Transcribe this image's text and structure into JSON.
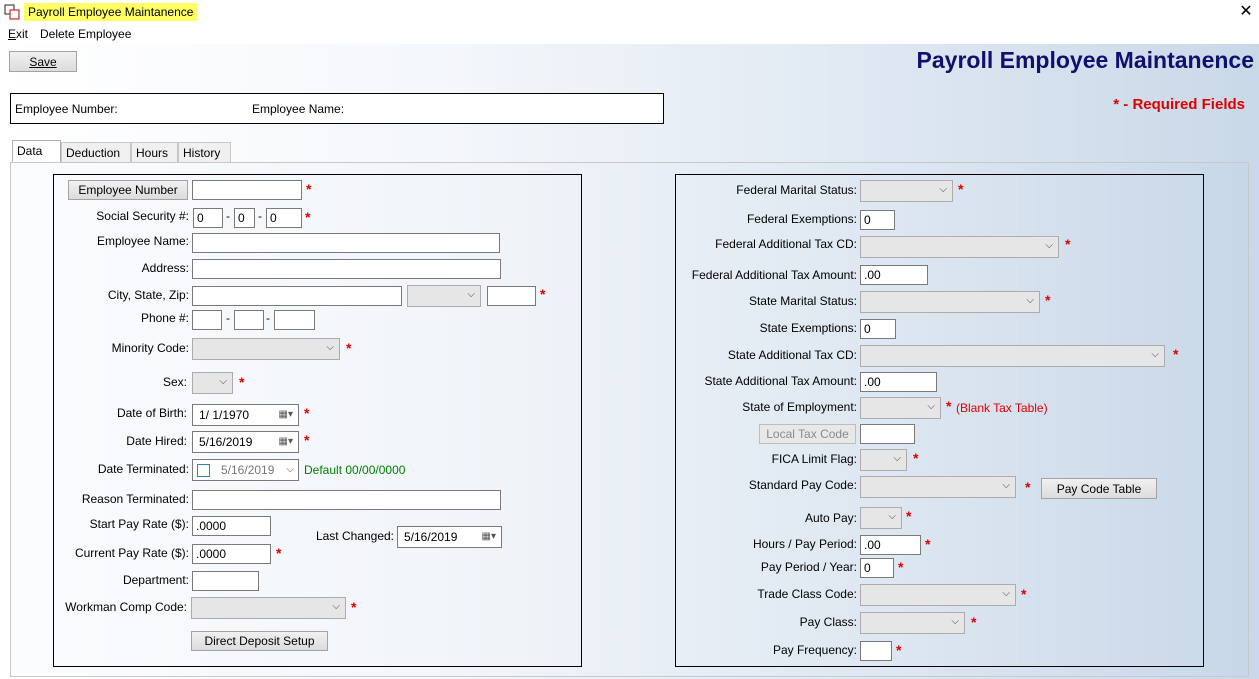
{
  "window": {
    "title": "Payroll Employee Maintanence",
    "close_glyph": "✕"
  },
  "menu": {
    "exit": "Exit",
    "exit_underline": "E",
    "exit_rest": "xit",
    "delete": "Delete Employee"
  },
  "toolbar": {
    "save": "Save"
  },
  "heading": "Payroll Employee Maintanence",
  "required_legend": "* -  Required Fields",
  "employee_box": {
    "number_label": "Employee Number:",
    "name_label": "Employee Name:"
  },
  "tabs": [
    "Data",
    "Deduction",
    "Hours",
    "History"
  ],
  "left": {
    "employee_number_btn": "Employee Number",
    "ssn_label": "Social Security #:",
    "ssn1": "0",
    "ssn2": "0",
    "ssn3": "0",
    "dash": "-",
    "name_label": "Employee Name:",
    "address_label": "Address:",
    "csz_label": "City, State, Zip:",
    "phone_label": "Phone #:",
    "minority_label": "Minority Code:",
    "sex_label": "Sex:",
    "dob_label": "Date of Birth:",
    "dob": "1/  1/1970",
    "hired_label": "Date Hired:",
    "hired": "5/16/2019",
    "term_label": "Date Terminated:",
    "term": "5/16/2019",
    "term_default": "Default 00/00/0000",
    "reason_label": "Reason Terminated:",
    "start_rate_label": "Start Pay Rate ($):",
    "start_rate": ".0000",
    "current_rate_label": "Current Pay Rate ($):",
    "current_rate": ".0000",
    "last_changed_label": "Last Changed:",
    "last_changed": "5/16/2019",
    "department_label": "Department:",
    "workman_label": "Workman Comp Code:",
    "direct_deposit_btn": "Direct Deposit Setup"
  },
  "right": {
    "fed_marital_label": "Federal Marital Status:",
    "fed_exempt_label": "Federal Exemptions:",
    "fed_exempt": "0",
    "fed_add_cd_label": "Federal Additional Tax CD:",
    "fed_add_amt_label": "Federal Additional Tax Amount:",
    "fed_add_amt": ".00",
    "state_marital_label": "State Marital Status:",
    "state_exempt_label": "State Exemptions:",
    "state_exempt": "0",
    "state_add_cd_label": "State Additional Tax CD:",
    "state_add_amt_label": "State Additional Tax Amount:",
    "state_add_amt": ".00",
    "state_emp_label": "State of Employment:",
    "blank_tax_note": "(Blank Tax Table)",
    "local_tax_btn": "Local Tax Code",
    "fica_label": "FICA Limit Flag:",
    "std_pay_label": "Standard Pay Code:",
    "pay_code_btn": "Pay Code Table",
    "auto_pay_label": "Auto Pay:",
    "hours_pp_label": "Hours / Pay Period:",
    "hours_pp": ".00",
    "pp_year_label": "Pay Period / Year:",
    "pp_year": "0",
    "trade_label": "Trade Class Code:",
    "pay_class_label": "Pay Class:",
    "pay_freq_label": "Pay Frequency:"
  },
  "star": "*",
  "icons": {
    "chevron": "⌵",
    "calendar": "▦▾",
    "chev_dd": "▾"
  }
}
